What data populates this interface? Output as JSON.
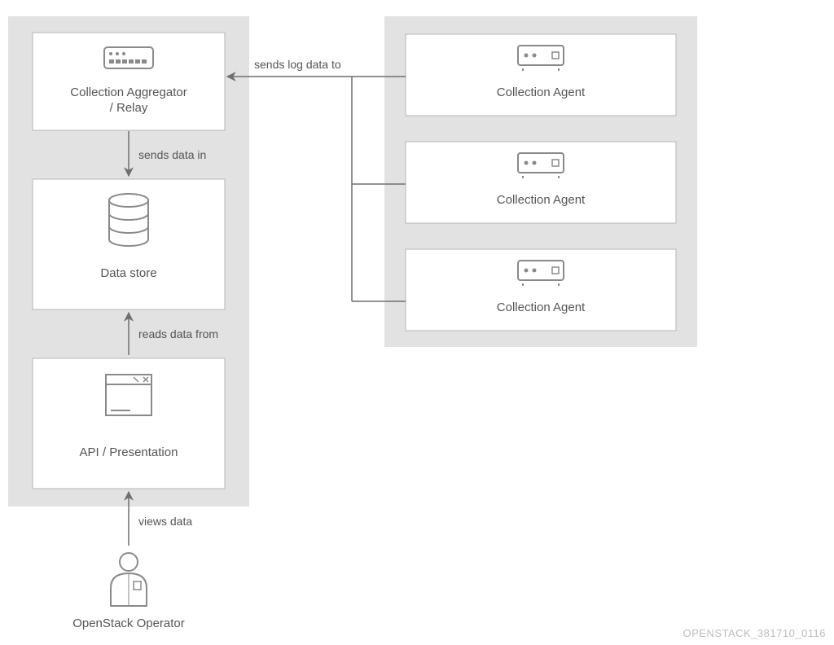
{
  "left_group": {
    "aggregator": {
      "line1": "Collection Aggregator",
      "line2": "/ Relay"
    },
    "datastore": {
      "label": "Data store"
    },
    "api": {
      "label": "API / Presentation"
    }
  },
  "right_group": {
    "agents": [
      {
        "label": "Collection Agent"
      },
      {
        "label": "Collection Agent"
      },
      {
        "label": "Collection Agent"
      }
    ]
  },
  "actor": {
    "label": "OpenStack Operator"
  },
  "edges": {
    "agents_to_aggregator": "sends log data to",
    "aggregator_to_store": "sends data in",
    "api_to_store": "reads data from",
    "operator_to_api": "views data"
  },
  "footer": "OPENSTACK_381710_0116",
  "colors": {
    "group_bg": "#e2e2e2",
    "box_bg": "#ffffff",
    "stroke": "#6f6f6f",
    "icon": "#8a8a8a"
  }
}
